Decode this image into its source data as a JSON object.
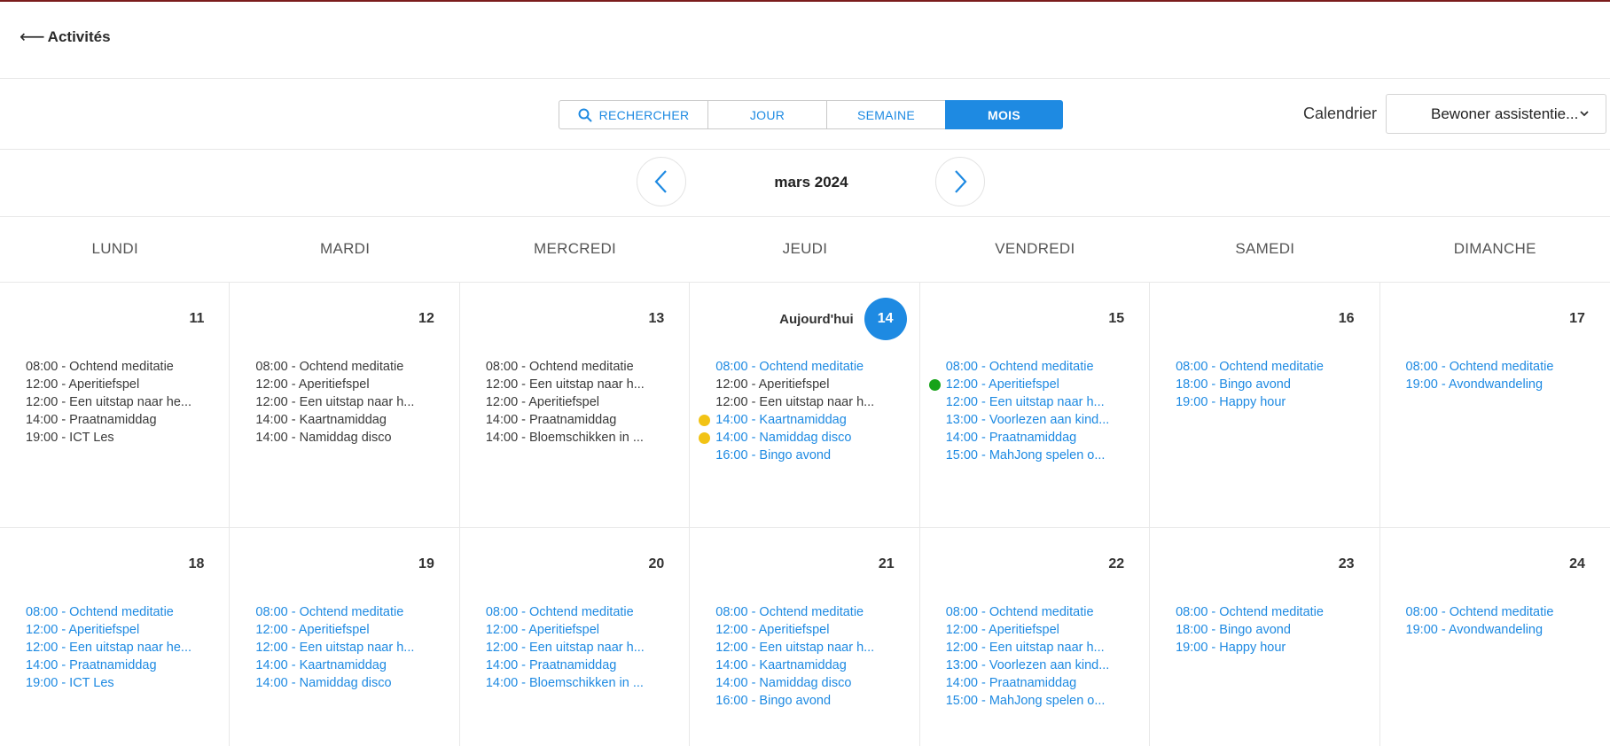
{
  "header": {
    "back_arrow": "⟵",
    "back_label": "Activités"
  },
  "toolbar": {
    "views": [
      {
        "label": "RECHERCHER",
        "icon": "search-icon",
        "active": false
      },
      {
        "label": "JOUR",
        "active": false
      },
      {
        "label": "SEMAINE",
        "active": false
      },
      {
        "label": "MOIS",
        "active": true
      }
    ],
    "calendar_label": "Calendrier",
    "calendar_value": "Bewoner assistentie..."
  },
  "month": {
    "title": "mars 2024"
  },
  "weekdays": [
    "LUNDI",
    "MARDI",
    "MERCREDI",
    "JEUDI",
    "VENDREDI",
    "SAMEDI",
    "DIMANCHE"
  ],
  "today_label": "Aujourd'hui",
  "colors": {
    "accent": "#1e8ae2",
    "dot_yellow": "#f2c315",
    "dot_green": "#17a319"
  },
  "weeks": [
    [
      {
        "date": "11",
        "events": [
          {
            "text": "08:00 - Ochtend meditatie",
            "upcoming": false
          },
          {
            "text": "12:00 - Aperitiefspel",
            "upcoming": false
          },
          {
            "text": "12:00 - Een uitstap naar he...",
            "upcoming": false
          },
          {
            "text": "14:00 - Praatnamiddag",
            "upcoming": false
          },
          {
            "text": "19:00 - ICT Les",
            "upcoming": false
          }
        ]
      },
      {
        "date": "12",
        "events": [
          {
            "text": "08:00 - Ochtend meditatie",
            "upcoming": false
          },
          {
            "text": "12:00 - Aperitiefspel",
            "upcoming": false
          },
          {
            "text": "12:00 - Een uitstap naar h...",
            "upcoming": false
          },
          {
            "text": "14:00 - Kaartnamiddag",
            "upcoming": false
          },
          {
            "text": "14:00 - Namiddag disco",
            "upcoming": false
          }
        ]
      },
      {
        "date": "13",
        "events": [
          {
            "text": "08:00 - Ochtend meditatie",
            "upcoming": false
          },
          {
            "text": "12:00 - Een uitstap naar h...",
            "upcoming": false
          },
          {
            "text": "12:00 - Aperitiefspel",
            "upcoming": false
          },
          {
            "text": "14:00 - Praatnamiddag",
            "upcoming": false
          },
          {
            "text": "14:00 - Bloemschikken in ...",
            "upcoming": false
          }
        ]
      },
      {
        "date": "14",
        "today": true,
        "events": [
          {
            "text": "08:00 - Ochtend meditatie",
            "upcoming": true
          },
          {
            "text": "12:00 - Aperitiefspel",
            "upcoming": false
          },
          {
            "text": "12:00 - Een uitstap naar h...",
            "upcoming": false
          },
          {
            "text": "14:00 - Kaartnamiddag",
            "upcoming": true,
            "dot": "yellow"
          },
          {
            "text": "14:00 - Namiddag disco",
            "upcoming": true,
            "dot": "yellow"
          },
          {
            "text": "16:00 - Bingo avond",
            "upcoming": true
          }
        ]
      },
      {
        "date": "15",
        "events": [
          {
            "text": "08:00 - Ochtend meditatie",
            "upcoming": true
          },
          {
            "text": "12:00 - Aperitiefspel",
            "upcoming": true,
            "dot": "green"
          },
          {
            "text": "12:00 - Een uitstap naar h...",
            "upcoming": true
          },
          {
            "text": "13:00 - Voorlezen aan kind...",
            "upcoming": true
          },
          {
            "text": "14:00 - Praatnamiddag",
            "upcoming": true
          },
          {
            "text": "15:00 - MahJong spelen o...",
            "upcoming": true
          }
        ]
      },
      {
        "date": "16",
        "events": [
          {
            "text": "08:00 - Ochtend meditatie",
            "upcoming": true
          },
          {
            "text": "18:00 - Bingo avond",
            "upcoming": true
          },
          {
            "text": "19:00 - Happy hour",
            "upcoming": true
          }
        ]
      },
      {
        "date": "17",
        "events": [
          {
            "text": "08:00 - Ochtend meditatie",
            "upcoming": true
          },
          {
            "text": "19:00 - Avondwandeling",
            "upcoming": true
          }
        ]
      }
    ],
    [
      {
        "date": "18",
        "events": [
          {
            "text": "08:00 - Ochtend meditatie",
            "upcoming": true
          },
          {
            "text": "12:00 - Aperitiefspel",
            "upcoming": true
          },
          {
            "text": "12:00 - Een uitstap naar he...",
            "upcoming": true
          },
          {
            "text": "14:00 - Praatnamiddag",
            "upcoming": true
          },
          {
            "text": "19:00 - ICT Les",
            "upcoming": true
          }
        ]
      },
      {
        "date": "19",
        "events": [
          {
            "text": "08:00 - Ochtend meditatie",
            "upcoming": true
          },
          {
            "text": "12:00 - Aperitiefspel",
            "upcoming": true
          },
          {
            "text": "12:00 - Een uitstap naar h...",
            "upcoming": true
          },
          {
            "text": "14:00 - Kaartnamiddag",
            "upcoming": true
          },
          {
            "text": "14:00 - Namiddag disco",
            "upcoming": true
          }
        ]
      },
      {
        "date": "20",
        "events": [
          {
            "text": "08:00 - Ochtend meditatie",
            "upcoming": true
          },
          {
            "text": "12:00 - Aperitiefspel",
            "upcoming": true
          },
          {
            "text": "12:00 - Een uitstap naar h...",
            "upcoming": true
          },
          {
            "text": "14:00 - Praatnamiddag",
            "upcoming": true
          },
          {
            "text": "14:00 - Bloemschikken in ...",
            "upcoming": true
          }
        ]
      },
      {
        "date": "21",
        "events": [
          {
            "text": "08:00 - Ochtend meditatie",
            "upcoming": true
          },
          {
            "text": "12:00 - Aperitiefspel",
            "upcoming": true
          },
          {
            "text": "12:00 - Een uitstap naar h...",
            "upcoming": true
          },
          {
            "text": "14:00 - Kaartnamiddag",
            "upcoming": true
          },
          {
            "text": "14:00 - Namiddag disco",
            "upcoming": true
          },
          {
            "text": "16:00 - Bingo avond",
            "upcoming": true
          }
        ]
      },
      {
        "date": "22",
        "events": [
          {
            "text": "08:00 - Ochtend meditatie",
            "upcoming": true
          },
          {
            "text": "12:00 - Aperitiefspel",
            "upcoming": true
          },
          {
            "text": "12:00 - Een uitstap naar h...",
            "upcoming": true
          },
          {
            "text": "13:00 - Voorlezen aan kind...",
            "upcoming": true
          },
          {
            "text": "14:00 - Praatnamiddag",
            "upcoming": true
          },
          {
            "text": "15:00 - MahJong spelen o...",
            "upcoming": true
          }
        ]
      },
      {
        "date": "23",
        "events": [
          {
            "text": "08:00 - Ochtend meditatie",
            "upcoming": true
          },
          {
            "text": "18:00 - Bingo avond",
            "upcoming": true
          },
          {
            "text": "19:00 - Happy hour",
            "upcoming": true
          }
        ]
      },
      {
        "date": "24",
        "events": [
          {
            "text": "08:00 - Ochtend meditatie",
            "upcoming": true
          },
          {
            "text": "19:00 - Avondwandeling",
            "upcoming": true
          }
        ]
      }
    ]
  ]
}
